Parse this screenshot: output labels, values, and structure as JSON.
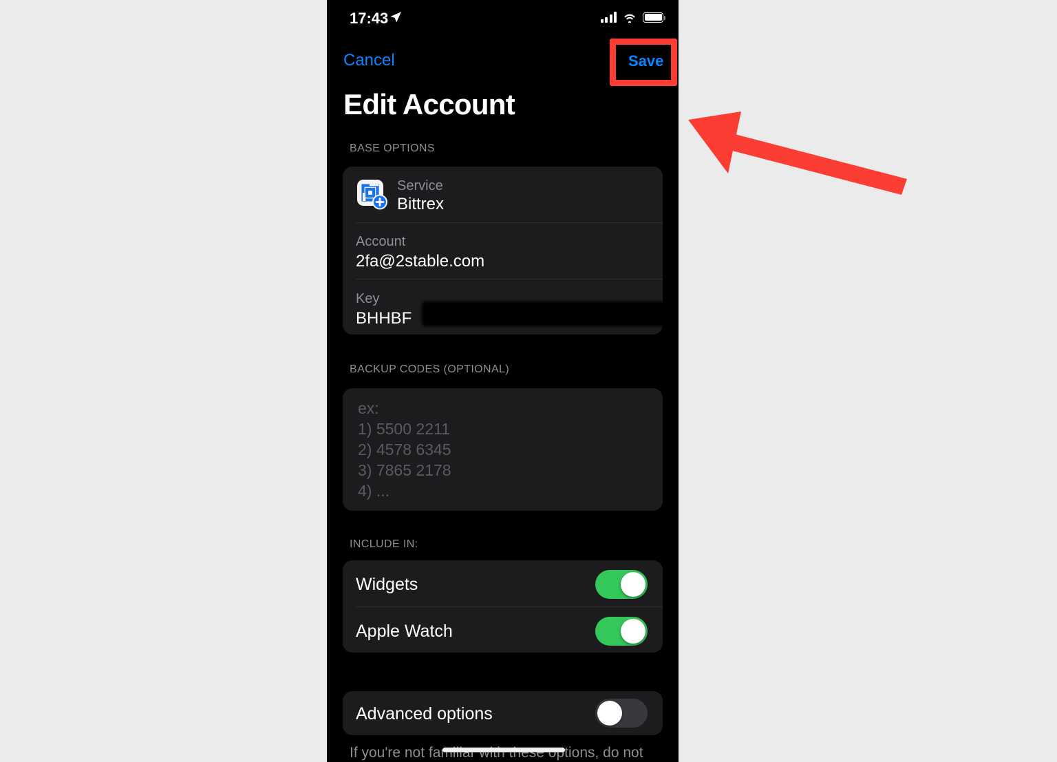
{
  "status_bar": {
    "time": "17:43",
    "location_icon": "location-arrow-icon",
    "cellular_icon": "cellular-signal-icon",
    "wifi_icon": "wifi-icon",
    "battery_icon": "battery-full-icon"
  },
  "nav": {
    "cancel_label": "Cancel",
    "save_label": "Save"
  },
  "page_title": "Edit Account",
  "sections": {
    "base_options": {
      "header": "BASE OPTIONS",
      "service_label": "Service",
      "service_value": "Bittrex",
      "service_icon": "bittrex-add-service-icon",
      "account_label": "Account",
      "account_value": "2fa@2stable.com",
      "key_label": "Key",
      "key_value": "BHHBF",
      "key_redacted": true
    },
    "backup_codes": {
      "header": "BACKUP CODES (OPTIONAL)",
      "placeholder": "ex:\n1) 5500 2211\n2) 4578 6345\n3) 7865 2178\n4) ...",
      "value": ""
    },
    "include_in": {
      "header": "INCLUDE IN:",
      "rows": [
        {
          "label": "Widgets",
          "state": "on"
        },
        {
          "label": "Apple Watch",
          "state": "on"
        }
      ]
    },
    "advanced": {
      "label": "Advanced options",
      "state": "off",
      "footer_note": "If you're not familiar with these options, do not"
    }
  },
  "colors": {
    "accent_blue": "#0a84ff",
    "toggle_on_green": "#34c759",
    "toggle_off_gray": "#39393d",
    "annotation_red": "#fc3d33",
    "card_background": "#1c1c1e",
    "page_background": "#ebebeb"
  },
  "annotations": {
    "highlight_target": "Save",
    "arrow": "points-to-save-button"
  }
}
